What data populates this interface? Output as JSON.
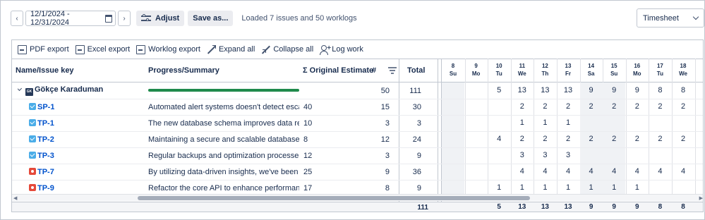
{
  "toolbar": {
    "prev_icon": "chevron-left-icon",
    "next_icon": "chevron-right-icon",
    "date_range": "12/1/2024 - 12/31/2024",
    "adjust_label": "Adjust",
    "save_as_label": "Save as...",
    "status": "Loaded 7 issues and 50 worklogs",
    "view_select": "Timesheet"
  },
  "actions": {
    "pdf": "PDF export",
    "excel": "Excel export",
    "worklog": "Worklog export",
    "expand": "Expand all",
    "collapse": "Collapse all",
    "log_work": "Log work"
  },
  "columns": {
    "name": "Name/Issue key",
    "summary": "Progress/Summary",
    "estimate": "Σ Original Estimate",
    "count": "#",
    "total": "Total"
  },
  "days": [
    {
      "num": "8",
      "dow": "Su"
    },
    {
      "num": "9",
      "dow": "Mo"
    },
    {
      "num": "10",
      "dow": "Tu"
    },
    {
      "num": "11",
      "dow": "We"
    },
    {
      "num": "12",
      "dow": "Th"
    },
    {
      "num": "13",
      "dow": "Fr"
    },
    {
      "num": "14",
      "dow": "Sa"
    },
    {
      "num": "15",
      "dow": "Su"
    },
    {
      "num": "16",
      "dow": "Mo"
    },
    {
      "num": "17",
      "dow": "Tu"
    },
    {
      "num": "18",
      "dow": "We"
    }
  ],
  "group": {
    "avatar": "GK",
    "name": "Gökçe Karaduman",
    "progress": 1.0,
    "count": "50",
    "total": "111",
    "days": [
      "",
      "",
      "5",
      "13",
      "13",
      "13",
      "9",
      "9",
      "9",
      "8",
      "8"
    ]
  },
  "rows": [
    {
      "type": "task",
      "key": "SP-1",
      "summary": "Automated alert systems doesn't detect escalate,it should",
      "estimate": "40",
      "count": "15",
      "total": "30",
      "days": [
        "",
        "",
        "",
        "2",
        "2",
        "2",
        "2",
        "2",
        "2",
        "2",
        "2"
      ]
    },
    {
      "type": "task",
      "key": "TP-1",
      "summary": "The new database schema improves data retrieval times",
      "estimate": "10",
      "count": "3",
      "total": "3",
      "days": [
        "",
        "",
        "",
        "1",
        "1",
        "1",
        "",
        "",
        "",
        "",
        ""
      ]
    },
    {
      "type": "task",
      "key": "TP-2",
      "summary": "Maintaining a secure and scalable database is key to our",
      "estimate": "8",
      "count": "12",
      "total": "24",
      "days": [
        "",
        "",
        "4",
        "2",
        "2",
        "2",
        "2",
        "2",
        "2",
        "2",
        "2"
      ]
    },
    {
      "type": "task",
      "key": "TP-3",
      "summary": "Regular backups and optimization processes are necessary",
      "estimate": "12",
      "count": "3",
      "total": "9",
      "days": [
        "",
        "",
        "",
        "3",
        "3",
        "3",
        "",
        "",
        "",
        "",
        ""
      ]
    },
    {
      "type": "bug",
      "key": "TP-7",
      "summary": "By utilizing data-driven insights, we've been able to reduce",
      "estimate": "25",
      "count": "9",
      "total": "36",
      "days": [
        "",
        "",
        "",
        "4",
        "4",
        "4",
        "4",
        "4",
        "4",
        "4",
        "4"
      ]
    },
    {
      "type": "bug",
      "key": "TP-9",
      "summary": "Refactor the core API to enhance performance, reducing",
      "estimate": "17",
      "count": "8",
      "total": "9",
      "days": [
        "",
        "",
        "1",
        "1",
        "1",
        "1",
        "1",
        "1",
        "1",
        "",
        ""
      ]
    }
  ],
  "footer": {
    "total": "111",
    "days": [
      "",
      "",
      "5",
      "13",
      "13",
      "13",
      "9",
      "9",
      "9",
      "8",
      "8"
    ]
  },
  "colors": {
    "accent": "#0052cc",
    "progress": "#1f8a4c",
    "weekend": "#f0f2f5"
  }
}
